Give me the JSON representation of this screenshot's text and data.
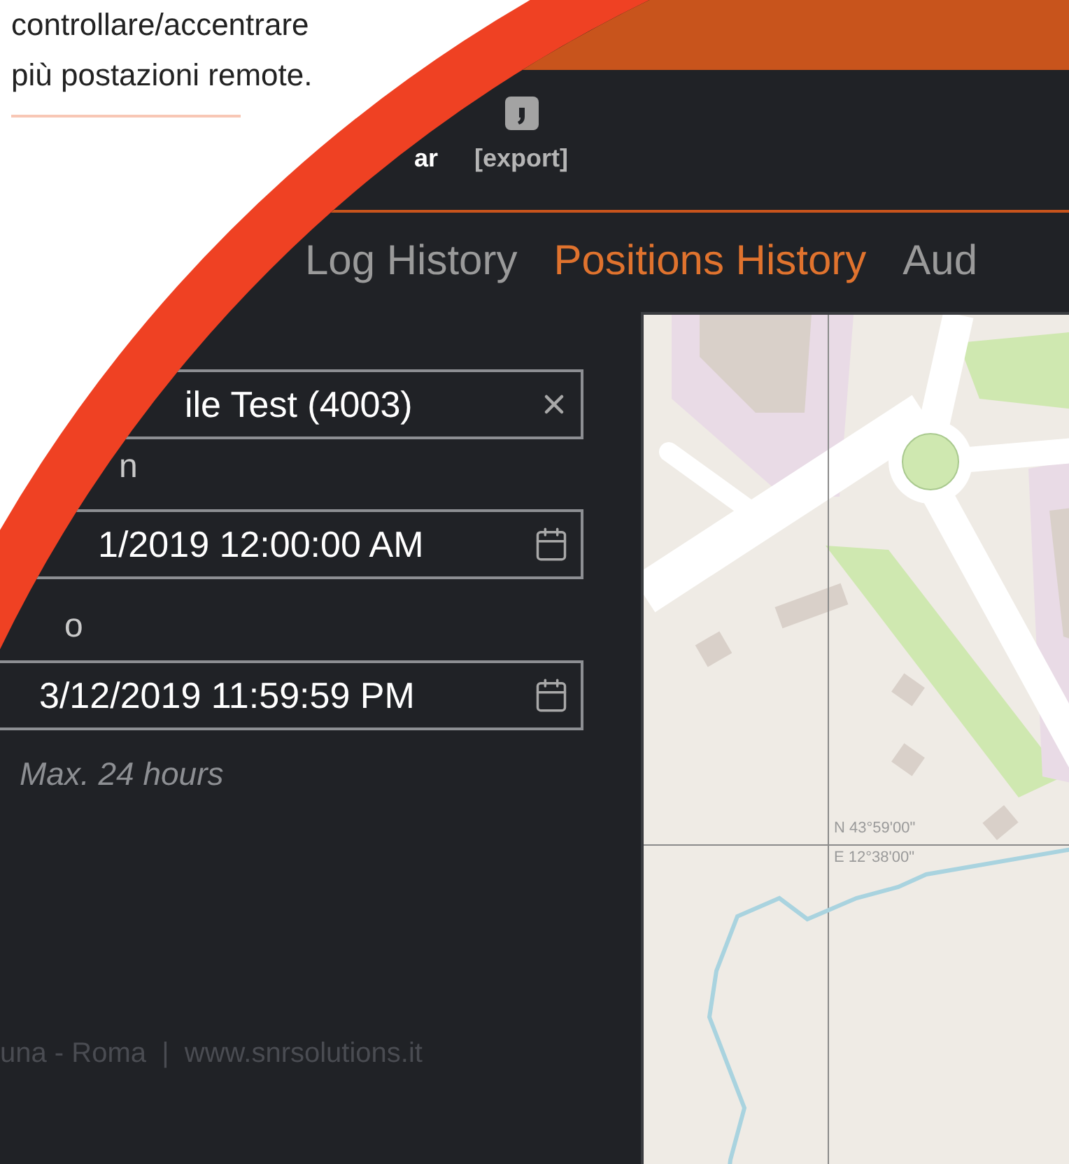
{
  "intro": {
    "text": "controllare/accentrare più postazioni remote."
  },
  "toolbar": [
    {
      "kind": "text",
      "label": "ar"
    },
    {
      "kind": "icon",
      "label": "[export]"
    }
  ],
  "tabs": [
    {
      "label": "Log History",
      "selected": false
    },
    {
      "label": "Positions History",
      "selected": true
    },
    {
      "label": "Aud",
      "selected": false
    }
  ],
  "vehicle_field": {
    "value": "ile Test (4003)"
  },
  "from_field": {
    "label": "n",
    "value": "1/2019 12:00:00 AM"
  },
  "to_field": {
    "label": "o",
    "value": "3/12/2019 11:59:59 PM"
  },
  "hint": "Max. 24 hours",
  "map": {
    "latitude": "N 43°59'00\"",
    "longitude": "E 12°38'00\""
  },
  "footer": "una - Roma  |  www.snrsolutions.it"
}
